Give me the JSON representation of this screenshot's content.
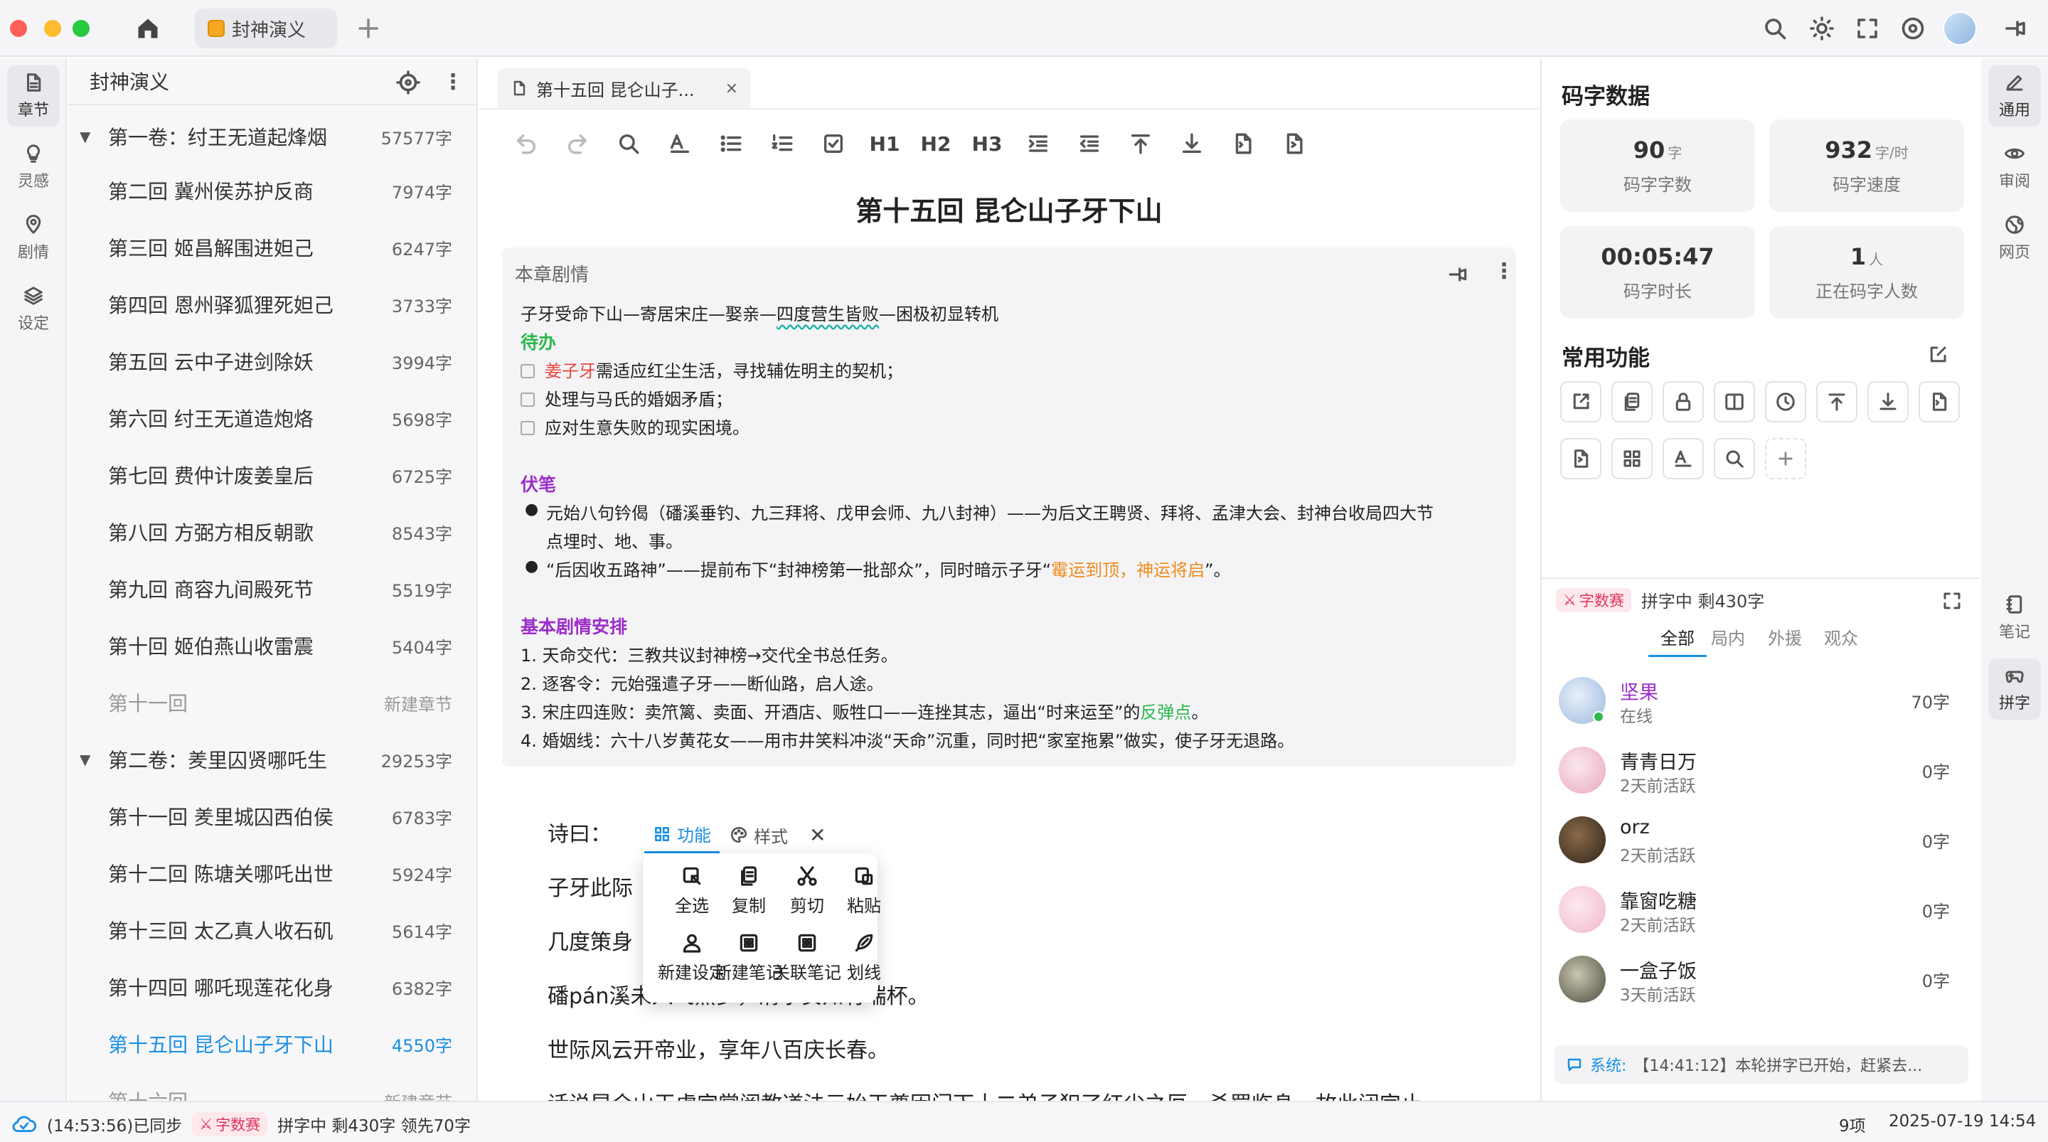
{
  "app": {
    "tab_title": "封神演义"
  },
  "left_rail": [
    {
      "label": "章节",
      "icon": "document-icon"
    },
    {
      "label": "灵感",
      "icon": "lightbulb-icon"
    },
    {
      "label": "剧情",
      "icon": "map-pin-icon"
    },
    {
      "label": "设定",
      "icon": "layers-icon"
    }
  ],
  "chapters": {
    "title": "封神演义",
    "rows": [
      {
        "kind": "vol",
        "title": "第一卷：纣王无道起烽烟",
        "count": "57577字"
      },
      {
        "kind": "ch",
        "title": "第二回 冀州侯苏护反商",
        "count": "7974字"
      },
      {
        "kind": "ch",
        "title": "第三回 姬昌解围进妲己",
        "count": "6247字"
      },
      {
        "kind": "ch",
        "title": "第四回 恩州驿狐狸死妲己",
        "count": "3733字"
      },
      {
        "kind": "ch",
        "title": "第五回 云中子进剑除妖",
        "count": "3994字"
      },
      {
        "kind": "ch",
        "title": "第六回 纣王无道造炮烙",
        "count": "5698字"
      },
      {
        "kind": "ch",
        "title": "第七回 费仲计废姜皇后",
        "count": "6725字"
      },
      {
        "kind": "ch",
        "title": "第八回 方弼方相反朝歌",
        "count": "8543字"
      },
      {
        "kind": "ch",
        "title": "第九回 商容九间殿死节",
        "count": "5519字"
      },
      {
        "kind": "ch",
        "title": "第十回 姬伯燕山收雷震",
        "count": "5404字"
      },
      {
        "kind": "ghost",
        "title": "第十一回",
        "count": "新建章节"
      },
      {
        "kind": "vol",
        "title": "第二卷：羑里囚贤哪吒生",
        "count": "29253字"
      },
      {
        "kind": "ch",
        "title": "第十一回 羑里城囚西伯侯",
        "count": "6783字"
      },
      {
        "kind": "ch",
        "title": "第十二回 陈塘关哪吒出世",
        "count": "5924字"
      },
      {
        "kind": "ch",
        "title": "第十三回 太乙真人收石矶",
        "count": "5614字"
      },
      {
        "kind": "ch",
        "title": "第十四回 哪吒现莲花化身",
        "count": "6382字"
      },
      {
        "kind": "cur",
        "title": "第十五回 昆仑山子牙下山",
        "count": "4550字"
      },
      {
        "kind": "ghost",
        "title": "第十六回",
        "count": "新建章节"
      }
    ]
  },
  "editor": {
    "tab_label": "第十五回 昆仑山子...",
    "toolbar": [
      "H1",
      "H2",
      "H3"
    ],
    "title": "第十五回 昆仑山子牙下山",
    "plot": {
      "label": "本章剧情",
      "summary_a": "子牙受命下山—寄居宋庄—娶亲—",
      "summary_b": "四度营生皆败",
      "summary_c": "—困极初显转机",
      "todo_head": "待办",
      "todo1_name": "姜子牙",
      "todo1_rest": "需适应红尘生活，寻找辅佐明主的契机；",
      "todo2": "处理与马氏的婚姻矛盾；",
      "todo3": "应对生意失败的现实困境。",
      "fb_head": "伏笔",
      "fb1a": "元始八句钤偈（磻溪垂钓、九三拜将、戊甲会师、九八封神）——为后文王聘贤、拜将、孟津大会、封神台收局四大节",
      "fb1b": "点埋时、地、事。",
      "fb2a": "“后因收五路神”——提前布下“封神榜第一批部众”，同时暗示子牙“",
      "fb2b": "霉运到顶，神运将启",
      "fb2c": "”。",
      "arr_head": "基本剧情安排",
      "arr1": "1.  天命交代：三教共议封神榜→交代全书总任务。",
      "arr2": "2.  逐客令：元始强遣子牙——断仙路，启人途。",
      "arr3a": "3.  宋庄四连败：卖笊篱、卖面、开酒店、贩牲口——连挫其志，逼出“时来运至”的",
      "arr3b": "反弹点",
      "arr3c": "。",
      "arr4": "4.  婚姻线：六十八岁黄花女——用市井笑料冲淡“天命”沉重，同时把“家室拖累”做实，使子牙无退路。"
    },
    "body": {
      "l1": "诗曰：",
      "l2": "子牙此际",
      "l3": "几度策身",
      "l4": "磻pán溪未入飞熊梦，渭水安知有瑞杯。",
      "l5": "世际风云开帝业，享年八百庆长春。",
      "l6": "话说昆仑山玉虚宫掌阐教道法元始天尊因门下十二弟子犯了红尘之厄，杀罚临身，故此闭宫止"
    },
    "popup": {
      "tab_func": "功能",
      "tab_style": "样式",
      "items": [
        "全选",
        "复制",
        "剪切",
        "粘贴",
        "新建设定",
        "新建笔记",
        "关联笔记",
        "划线"
      ]
    }
  },
  "stats": {
    "title": "码字数据",
    "cards": [
      {
        "value": "90",
        "unit": "字",
        "label": "码字字数"
      },
      {
        "value": "932",
        "unit": "字/时",
        "label": "码字速度"
      },
      {
        "value": "00:05:47",
        "unit": "",
        "label": "码字时长"
      },
      {
        "value": "1",
        "unit": "人",
        "label": "正在码字人数"
      }
    ]
  },
  "common": {
    "title": "常用功能"
  },
  "race": {
    "badge": "字数赛",
    "status": "拼字中 剩430字",
    "tabs": [
      "全部",
      "局内",
      "外援",
      "观众"
    ],
    "users": [
      {
        "name": "坚果",
        "state": "在线",
        "words": "70字",
        "highlight": true
      },
      {
        "name": "青青日万",
        "state": "2天前活跃",
        "words": "0字",
        "highlight": false
      },
      {
        "name": "orz",
        "state": "2天前活跃",
        "words": "0字",
        "highlight": false
      },
      {
        "name": "靠窗吃糖",
        "state": "2天前活跃",
        "words": "0字",
        "highlight": false
      },
      {
        "name": "一盒子饭",
        "state": "3天前活跃",
        "words": "0字",
        "highlight": false
      }
    ],
    "sys_label": "系统:",
    "sys_msg": "【14:41:12】本轮拼字已开始，赶紧去..."
  },
  "right_rail": [
    {
      "label": "通用",
      "icon": "pen-icon"
    },
    {
      "label": "审阅",
      "icon": "eye-icon"
    },
    {
      "label": "网页",
      "icon": "globe-icon"
    },
    {
      "label": "笔记",
      "icon": "notebook-icon"
    },
    {
      "label": "拼字",
      "icon": "gamepad-icon"
    }
  ],
  "statusbar": {
    "sync": "(14:53:56)已同步",
    "badge": "字数赛",
    "race": "拼字中  剩430字 领先70字",
    "items": "9项",
    "datetime": "2025-07-19 14:54"
  },
  "colors": {
    "accent": "#1a8fe3",
    "green": "#2db84d",
    "purple": "#9b2fc9",
    "orange": "#f08a1c",
    "red": "#e8453c",
    "badge_red": "#e0355b"
  }
}
